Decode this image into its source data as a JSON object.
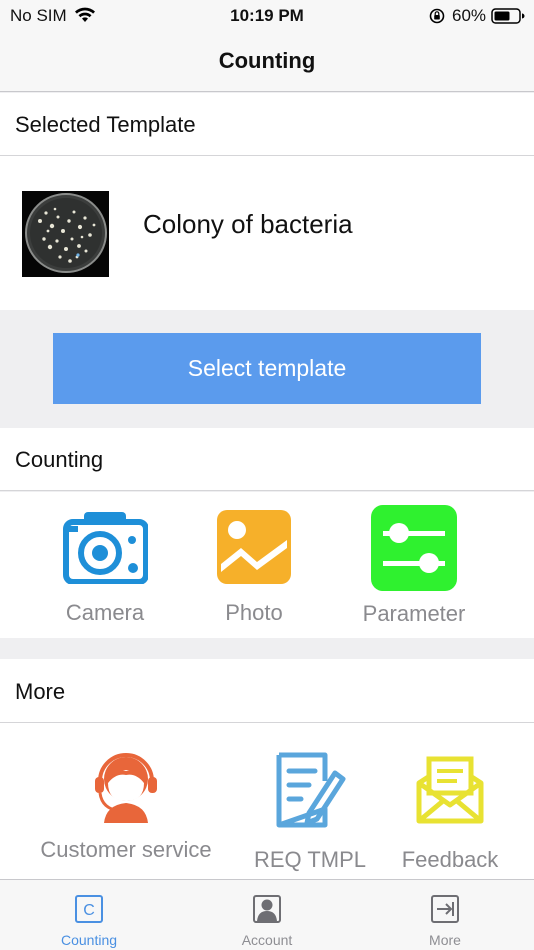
{
  "status_bar": {
    "carrier": "No SIM",
    "time": "10:19 PM",
    "battery": "60%"
  },
  "nav": {
    "title": "Counting"
  },
  "selected_template": {
    "header": "Selected Template",
    "name": "Colony of bacteria",
    "button": "Select template"
  },
  "counting": {
    "header": "Counting",
    "items": [
      {
        "label": "Camera",
        "icon": "camera-icon",
        "color": "#1e8fd8"
      },
      {
        "label": "Photo",
        "icon": "photo-icon",
        "color": "#f6b02a"
      },
      {
        "label": "Parameter",
        "icon": "sliders-icon",
        "color": "#2ff12f"
      }
    ]
  },
  "more": {
    "header": "More",
    "items": [
      {
        "label": "Customer service",
        "icon": "headset-icon",
        "color": "#e8663a"
      },
      {
        "label": "REQ TMPL",
        "icon": "request-template-icon",
        "color": "#5aa6dc"
      },
      {
        "label": "Feedback",
        "icon": "feedback-envelope-icon",
        "color": "#e8e232"
      }
    ]
  },
  "tab_bar": {
    "items": [
      {
        "label": "Counting",
        "icon_letter": "C",
        "active": true,
        "color": "#4a90e2"
      },
      {
        "label": "Account",
        "active": false
      },
      {
        "label": "More",
        "active": false
      }
    ]
  }
}
